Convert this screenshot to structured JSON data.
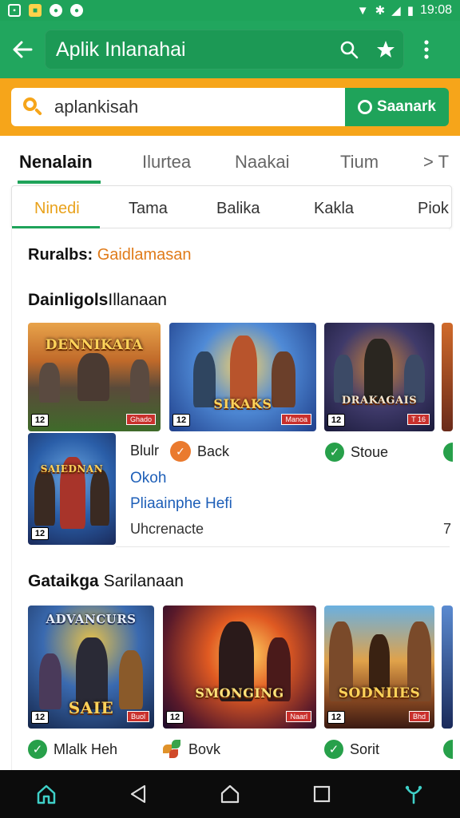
{
  "status_bar": {
    "left_icons": [
      "sim-icon",
      "notification-icon",
      "message-icon",
      "chat-icon"
    ],
    "time": "19:08"
  },
  "app_bar": {
    "title": "Aplik Inlanahai"
  },
  "search": {
    "value": "aplankisah",
    "button_label": "Saanark"
  },
  "primary_tabs": [
    {
      "label": "Nenalain",
      "active": true
    },
    {
      "label": "Ilurtea",
      "active": false
    },
    {
      "label": "Naakai",
      "active": false
    },
    {
      "label": "Tium",
      "active": false
    },
    {
      "label": "> T",
      "active": false
    }
  ],
  "secondary_tabs": [
    {
      "label": "Ninedi",
      "active": true
    },
    {
      "label": "Tama",
      "active": false
    },
    {
      "label": "Balika",
      "active": false
    },
    {
      "label": "Kakla",
      "active": false
    },
    {
      "label": "Piok",
      "active": false
    }
  ],
  "results": {
    "label": "Ruralbs:",
    "value": "Gaidlamasan"
  },
  "section1": {
    "title_bold": "Dainligols",
    "title_rest": "Illanaan",
    "games": [
      {
        "caption": "DENNIKATA",
        "age": "12",
        "price": "Ghado"
      },
      {
        "caption": "SIKAKS",
        "age": "12",
        "price": "Manoa"
      },
      {
        "caption": "DRAKAGAIS",
        "age": "12",
        "price": "T 16"
      }
    ],
    "detail": {
      "caption": "SAIEDNAN",
      "age": "12",
      "line1_label": "Blulr",
      "badge_label": "Back",
      "check_label": "Stoue",
      "link1": "Okoh",
      "link2": "Pliaainphe Hefi",
      "plain": "Uhcrenacte",
      "right_mark": "7"
    }
  },
  "section2": {
    "title_bold": "Gataikga",
    "title_rest": "Sarilanaan",
    "games": [
      {
        "caption": "ADVANCURS",
        "sub": "SAIE",
        "age": "12",
        "price": "Buol",
        "meta": "Mlalk Heh",
        "meta_icon": "check-icon"
      },
      {
        "caption": "SMONGING",
        "age": "12",
        "price": "Naarl",
        "meta": "Bovk",
        "meta_icon": "leaf-icon"
      },
      {
        "caption": "SODNIIES",
        "age": "12",
        "price": "Bhd",
        "meta": "Sorit",
        "meta_icon": "check-icon"
      }
    ]
  },
  "colors": {
    "primary_green": "#1fa35a",
    "accent_orange": "#f6a51a",
    "link_blue": "#1e5fb8",
    "results_orange": "#e07b1a"
  }
}
